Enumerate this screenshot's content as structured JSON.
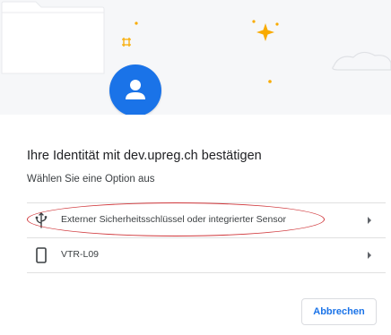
{
  "dialog": {
    "title": "Ihre Identität mit dev.upreg.ch bestätigen",
    "subtitle": "Wählen Sie eine Option aus"
  },
  "options": [
    {
      "label": "Externer Sicherheitsschlüssel oder integrierter Sensor",
      "icon": "usb-icon",
      "highlighted": true
    },
    {
      "label": "VTR-L09",
      "icon": "phone-icon",
      "highlighted": false
    }
  ],
  "actions": {
    "cancel_label": "Abbrechen"
  },
  "colors": {
    "accent": "#1a73e8",
    "highlight_ring": "#d0373b",
    "sparkle": "#f9ab00",
    "hero_background": "#f6f7f9"
  }
}
